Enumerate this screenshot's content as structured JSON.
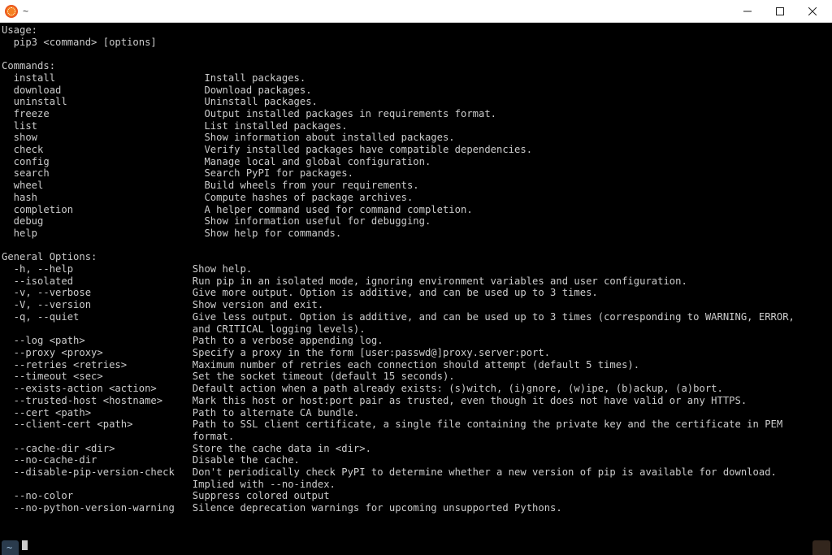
{
  "window": {
    "title": "~"
  },
  "usage": {
    "heading": "Usage:",
    "syntax": "pip3 <command> [options]"
  },
  "commands": {
    "heading": "Commands:",
    "items": [
      {
        "name": "install",
        "desc": "Install packages."
      },
      {
        "name": "download",
        "desc": "Download packages."
      },
      {
        "name": "uninstall",
        "desc": "Uninstall packages."
      },
      {
        "name": "freeze",
        "desc": "Output installed packages in requirements format."
      },
      {
        "name": "list",
        "desc": "List installed packages."
      },
      {
        "name": "show",
        "desc": "Show information about installed packages."
      },
      {
        "name": "check",
        "desc": "Verify installed packages have compatible dependencies."
      },
      {
        "name": "config",
        "desc": "Manage local and global configuration."
      },
      {
        "name": "search",
        "desc": "Search PyPI for packages."
      },
      {
        "name": "wheel",
        "desc": "Build wheels from your requirements."
      },
      {
        "name": "hash",
        "desc": "Compute hashes of package archives."
      },
      {
        "name": "completion",
        "desc": "A helper command used for command completion."
      },
      {
        "name": "debug",
        "desc": "Show information useful for debugging."
      },
      {
        "name": "help",
        "desc": "Show help for commands."
      }
    ]
  },
  "options": {
    "heading": "General Options:",
    "items": [
      {
        "flag": "-h, --help",
        "desc": "Show help."
      },
      {
        "flag": "--isolated",
        "desc": "Run pip in an isolated mode, ignoring environment variables and user configuration."
      },
      {
        "flag": "-v, --verbose",
        "desc": "Give more output. Option is additive, and can be used up to 3 times."
      },
      {
        "flag": "-V, --version",
        "desc": "Show version and exit."
      },
      {
        "flag": "-q, --quiet",
        "desc": "Give less output. Option is additive, and can be used up to 3 times (corresponding to WARNING, ERROR, and CRITICAL logging levels)."
      },
      {
        "flag": "--log <path>",
        "desc": "Path to a verbose appending log."
      },
      {
        "flag": "--proxy <proxy>",
        "desc": "Specify a proxy in the form [user:passwd@]proxy.server:port."
      },
      {
        "flag": "--retries <retries>",
        "desc": "Maximum number of retries each connection should attempt (default 5 times)."
      },
      {
        "flag": "--timeout <sec>",
        "desc": "Set the socket timeout (default 15 seconds)."
      },
      {
        "flag": "--exists-action <action>",
        "desc": "Default action when a path already exists: (s)witch, (i)gnore, (w)ipe, (b)ackup, (a)bort."
      },
      {
        "flag": "--trusted-host <hostname>",
        "desc": "Mark this host or host:port pair as trusted, even though it does not have valid or any HTTPS."
      },
      {
        "flag": "--cert <path>",
        "desc": "Path to alternate CA bundle."
      },
      {
        "flag": "--client-cert <path>",
        "desc": "Path to SSL client certificate, a single file containing the private key and the certificate in PEM format."
      },
      {
        "flag": "--cache-dir <dir>",
        "desc": "Store the cache data in <dir>."
      },
      {
        "flag": "--no-cache-dir",
        "desc": "Disable the cache."
      },
      {
        "flag": "--disable-pip-version-check",
        "desc": "Don't periodically check PyPI to determine whether a new version of pip is available for download. Implied with --no-index."
      },
      {
        "flag": "--no-color",
        "desc": "Suppress colored output"
      },
      {
        "flag": "--no-python-version-warning",
        "desc": "Silence deprecation warnings for upcoming unsupported Pythons."
      }
    ]
  },
  "layout": {
    "name_col_width": 32,
    "option_col_width": 30,
    "wrap_width": 136,
    "indent_names": "  ",
    "indent_flags": "  "
  },
  "statusbar": {
    "tab_label": "~",
    "prompt_char": "_"
  }
}
